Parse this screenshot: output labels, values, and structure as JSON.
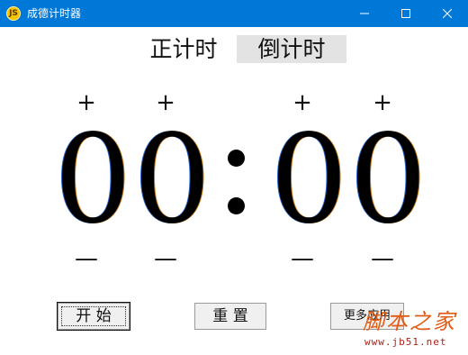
{
  "window": {
    "title": "成德计时器",
    "icon_text": "JS",
    "icons": [
      "app-icon",
      "minimize-icon",
      "maximize-icon",
      "close-icon"
    ]
  },
  "modes": {
    "count_up": "正计时",
    "count_down": "倒计时",
    "selected": "倒计时"
  },
  "timer": {
    "digits": [
      "0",
      "0",
      "0",
      "0"
    ],
    "separator": ":",
    "increment_symbol": "+",
    "decrement_symbol": "—"
  },
  "buttons": {
    "start": "开 始",
    "reset": "重 置",
    "more": "更多应用"
  },
  "watermark": {
    "main": "脚本之家",
    "url": "www.jb51.net"
  },
  "colors": {
    "titlebar": "#0078d7",
    "selected_tab": "#e3e3e3",
    "button_face": "#f0f0f0",
    "watermark": "#e05c14"
  }
}
